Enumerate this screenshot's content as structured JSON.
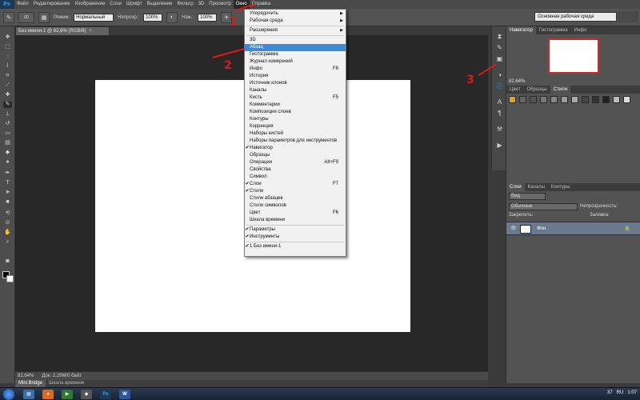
{
  "menubar": {
    "logo": "Ps",
    "items": [
      "Файл",
      "Редактирование",
      "Изображение",
      "Слои",
      "Шрифт",
      "Выделение",
      "Фильтр",
      "3D",
      "Просмотр",
      "Окно",
      "Справка"
    ],
    "active_index": 9
  },
  "options": {
    "mode_label": "Режим:",
    "mode_value": "Нормальный",
    "opacity_label": "Непрозр.:",
    "opacity_value": "100%",
    "pressure_label": "Наж.:",
    "pressure_value": "100%",
    "brush_size": "60",
    "workspace": "Основная рабочая среда"
  },
  "document": {
    "tab_title": "Без имени-1 @ 82,6% (RGB/8)",
    "tab_close": "×"
  },
  "status": {
    "zoom": "82,64%",
    "doc_info": "Док: 2,29M/0 байт"
  },
  "bottom_tabs": [
    "Mini Bridge",
    "Шкала времени"
  ],
  "panels": {
    "navigator_tabs": [
      "Навигатор",
      "Гистограмма",
      "Инфо"
    ],
    "navigator_zoom": "82,64%",
    "style_tabs": [
      "Цвет",
      "Образцы",
      "Стили"
    ],
    "layer_tabs": [
      "Слои",
      "Каналы",
      "Контуры"
    ],
    "kind_label": "Вид",
    "blend_mode": "Обычные",
    "opacity_label": "Непрозрачность:",
    "lock_label": "Закрепить:",
    "fill_label": "Заливка:",
    "layer_name": "Фон"
  },
  "window_menu": {
    "items": [
      {
        "label": "Упорядочить",
        "shortcut": "",
        "submenu": true,
        "checked": false,
        "highlight": false
      },
      {
        "label": "Рабочая среда",
        "shortcut": "",
        "submenu": true,
        "checked": false,
        "highlight": false
      },
      {
        "sep": true
      },
      {
        "label": "Расширения",
        "shortcut": "",
        "submenu": true,
        "checked": false,
        "highlight": false
      },
      {
        "sep": true
      },
      {
        "label": "3D",
        "shortcut": "",
        "submenu": false,
        "checked": false,
        "highlight": false
      },
      {
        "label": "Абзац",
        "shortcut": "",
        "submenu": false,
        "checked": false,
        "highlight": true
      },
      {
        "label": "Гистограмма",
        "shortcut": "",
        "submenu": false,
        "checked": false,
        "highlight": false
      },
      {
        "label": "Журнал измерений",
        "shortcut": "",
        "submenu": false,
        "checked": false,
        "highlight": false
      },
      {
        "label": "Инфо",
        "shortcut": "F8",
        "submenu": false,
        "checked": false,
        "highlight": false
      },
      {
        "label": "История",
        "shortcut": "",
        "submenu": false,
        "checked": false,
        "highlight": false
      },
      {
        "label": "Источник клонов",
        "shortcut": "",
        "submenu": false,
        "checked": false,
        "highlight": false
      },
      {
        "label": "Каналы",
        "shortcut": "",
        "submenu": false,
        "checked": false,
        "highlight": false
      },
      {
        "label": "Кисть",
        "shortcut": "F5",
        "submenu": false,
        "checked": false,
        "highlight": false
      },
      {
        "label": "Комментарии",
        "shortcut": "",
        "submenu": false,
        "checked": false,
        "highlight": false
      },
      {
        "label": "Композиции слоев",
        "shortcut": "",
        "submenu": false,
        "checked": false,
        "highlight": false
      },
      {
        "label": "Контуры",
        "shortcut": "",
        "submenu": false,
        "checked": false,
        "highlight": false
      },
      {
        "label": "Коррекция",
        "shortcut": "",
        "submenu": false,
        "checked": false,
        "highlight": false
      },
      {
        "label": "Наборы кистей",
        "shortcut": "",
        "submenu": false,
        "checked": false,
        "highlight": false
      },
      {
        "label": "Наборы параметров для инструментов",
        "shortcut": "",
        "submenu": false,
        "checked": false,
        "highlight": false
      },
      {
        "label": "Навигатор",
        "shortcut": "",
        "submenu": false,
        "checked": true,
        "highlight": false
      },
      {
        "label": "Образцы",
        "shortcut": "",
        "submenu": false,
        "checked": false,
        "highlight": false
      },
      {
        "label": "Операции",
        "shortcut": "Alt+F9",
        "submenu": false,
        "checked": false,
        "highlight": false
      },
      {
        "label": "Свойства",
        "shortcut": "",
        "submenu": false,
        "checked": false,
        "highlight": false
      },
      {
        "label": "Символ",
        "shortcut": "",
        "submenu": false,
        "checked": false,
        "highlight": false
      },
      {
        "label": "Слои",
        "shortcut": "F7",
        "submenu": false,
        "checked": true,
        "highlight": false
      },
      {
        "label": "Стили",
        "shortcut": "",
        "submenu": false,
        "checked": true,
        "highlight": false
      },
      {
        "label": "Стили абзацев",
        "shortcut": "",
        "submenu": false,
        "checked": false,
        "highlight": false
      },
      {
        "label": "Стили символов",
        "shortcut": "",
        "submenu": false,
        "checked": false,
        "highlight": false
      },
      {
        "label": "Цвет",
        "shortcut": "F6",
        "submenu": false,
        "checked": false,
        "highlight": false
      },
      {
        "label": "Шкала времени",
        "shortcut": "",
        "submenu": false,
        "checked": false,
        "highlight": false
      },
      {
        "sep": true
      },
      {
        "label": "Параметры",
        "shortcut": "",
        "submenu": false,
        "checked": true,
        "highlight": false
      },
      {
        "label": "Инструменты",
        "shortcut": "",
        "submenu": false,
        "checked": true,
        "highlight": false
      },
      {
        "sep": true
      },
      {
        "label": "1 Без имени-1",
        "shortcut": "",
        "submenu": false,
        "checked": true,
        "highlight": false
      }
    ]
  },
  "annotations": [
    "1",
    "2",
    "3"
  ],
  "taskbar": {
    "tray_count": "37",
    "tray_lang": "RU",
    "clock": "1:07"
  }
}
